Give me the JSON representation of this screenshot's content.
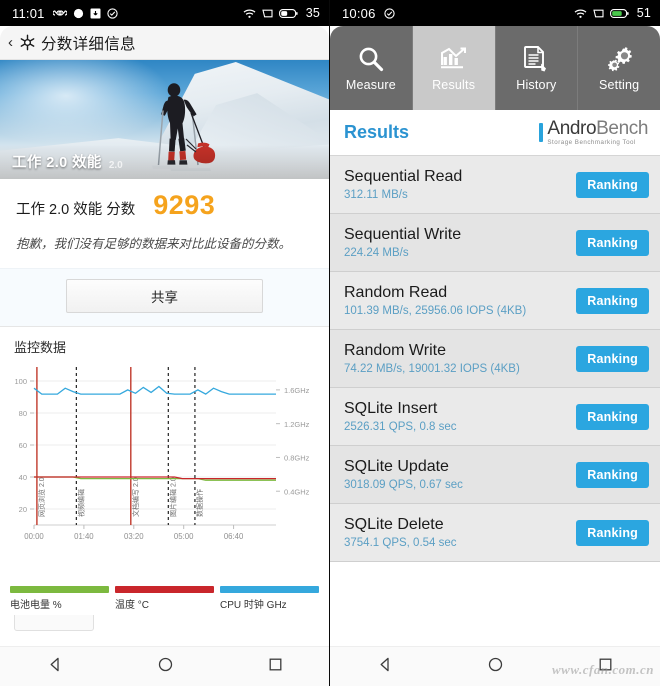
{
  "left_phone": {
    "status_bar": {
      "time": "11:01",
      "icons": [
        "infinity-icon",
        "message-icon",
        "download-icon",
        "check-circle-icon"
      ],
      "right_icons": [
        "wifi-icon",
        "sim-icon",
        "battery-icon"
      ],
      "battery_percent": "35"
    },
    "header": {
      "back_label": "‹",
      "app_icon": "pcmark-logo-icon",
      "title": "分数详细信息"
    },
    "hero": {
      "benchmark_name": "工作 2.0 效能",
      "version_badge": "2.0",
      "image_alt": "skier-pulling-sled-on-snow"
    },
    "score": {
      "label": "工作 2.0 效能 分数",
      "value": "9293",
      "value_color": "#f5a31d",
      "note": "抱歉，我们没有足够的数据来对比此设备的分数。"
    },
    "share_button": "共享",
    "monitor_section_title": "监控数据",
    "legend": [
      {
        "label": "电池电量 %",
        "color": "#7cb93f"
      },
      {
        "label": "温度 °C",
        "color": "#c9262b"
      },
      {
        "label": "CPU 时钟 GHz",
        "color": "#35a8dd"
      }
    ],
    "nav_bar": [
      "back-icon",
      "home-icon",
      "recents-icon"
    ]
  },
  "chart_data": {
    "type": "line",
    "title": "监控数据",
    "xlabel": "",
    "ylabel": "%",
    "x_ticks": [
      "00:00",
      "01:40",
      "03:20",
      "05:00",
      "06:40"
    ],
    "y_left_ticks": [
      "100",
      "80",
      "60",
      "40",
      "20"
    ],
    "ylim": [
      10,
      105
    ],
    "y_right_ticks": [
      "1.6GHz",
      "1.2GHz",
      "0.8GHz",
      "0.4GHz"
    ],
    "y_right_lim": [
      0,
      1.8
    ],
    "grid": true,
    "legend_position": "bottom",
    "annotations": [
      {
        "label": "网页浏览 2.0",
        "x": "00:05"
      },
      {
        "label": "视频编辑",
        "x": "01:15"
      },
      {
        "label": "文档编写 2.0",
        "x": "02:40"
      },
      {
        "label": "图片编辑 2.0",
        "x": "03:55"
      },
      {
        "label": "数据操作",
        "x": "04:45"
      }
    ],
    "series": [
      {
        "name": "CPU 时钟 GHz",
        "color": "#35a8dd",
        "axis": "right",
        "values": [
          1.62,
          1.55,
          1.55,
          1.55,
          1.62,
          1.58,
          1.55,
          1.55,
          1.55,
          1.55,
          1.55,
          1.55,
          1.6,
          1.56,
          1.63,
          1.57,
          1.64,
          1.56,
          1.55,
          1.55,
          1.55,
          1.6,
          1.55,
          1.62,
          1.58,
          1.55,
          1.55,
          1.55,
          1.55,
          1.55,
          1.55,
          1.55
        ]
      },
      {
        "name": "电池电量 %",
        "color": "#7cb93f",
        "axis": "left",
        "values": [
          40,
          40,
          40,
          40,
          40,
          40,
          39,
          39,
          39,
          39,
          39,
          39,
          39,
          39,
          39,
          39,
          39,
          39,
          39,
          39,
          39,
          39,
          38,
          38,
          38,
          38,
          38,
          38,
          38,
          38,
          38,
          38
        ]
      },
      {
        "name": "温度 °C",
        "color": "#c9262b",
        "axis": "left",
        "values": [
          40,
          40,
          40,
          40,
          40,
          40,
          40,
          40,
          40,
          40,
          40,
          40,
          40,
          40,
          40,
          40,
          40,
          40,
          40,
          39,
          39,
          39,
          39,
          39,
          39,
          39,
          39,
          39,
          39,
          39,
          39,
          39
        ]
      }
    ]
  },
  "right_phone": {
    "status_bar": {
      "time": "10:06",
      "icons": [
        "check-circle-icon"
      ],
      "right_icons": [
        "wifi-icon",
        "sim-icon",
        "battery-icon"
      ],
      "battery_percent": "51"
    },
    "tabs": [
      {
        "label": "Measure",
        "icon": "magnifier-icon",
        "active": false
      },
      {
        "label": "Results",
        "icon": "chart-icon",
        "active": true
      },
      {
        "label": "History",
        "icon": "document-icon",
        "active": false
      },
      {
        "label": "Setting",
        "icon": "gears-icon",
        "active": false
      }
    ],
    "header": {
      "title": "Results",
      "brand_part1": "Andro",
      "brand_part2": "Bench",
      "brand_sub": "Storage Benchmarking Tool"
    },
    "results": [
      {
        "name": "Sequential Read",
        "value": "312.11 MB/s",
        "button": "Ranking"
      },
      {
        "name": "Sequential Write",
        "value": "224.24 MB/s",
        "button": "Ranking"
      },
      {
        "name": "Random Read",
        "value": "101.39 MB/s, 25956.06 IOPS (4KB)",
        "button": "Ranking"
      },
      {
        "name": "Random Write",
        "value": "74.22 MB/s, 19001.32 IOPS (4KB)",
        "button": "Ranking"
      },
      {
        "name": "SQLite Insert",
        "value": "2526.31 QPS, 0.8 sec",
        "button": "Ranking"
      },
      {
        "name": "SQLite Update",
        "value": "3018.09 QPS, 0.67 sec",
        "button": "Ranking"
      },
      {
        "name": "SQLite Delete",
        "value": "3754.1 QPS, 0.54 sec",
        "button": "Ranking"
      }
    ],
    "nav_bar": [
      "back-icon",
      "home-icon",
      "recents-icon"
    ]
  },
  "watermark": "www.cfan.com.cn"
}
